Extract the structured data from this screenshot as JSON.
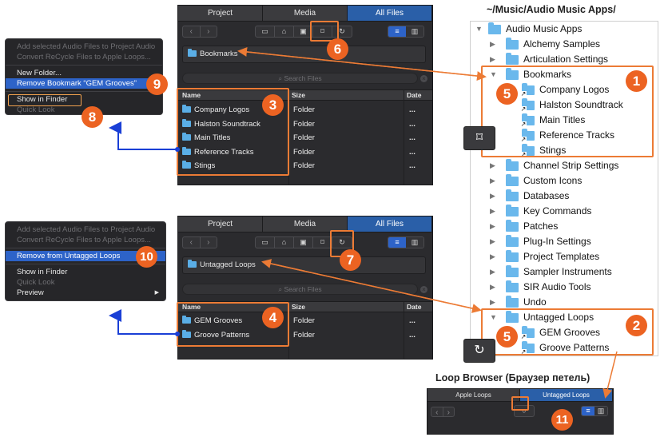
{
  "menu_top": {
    "items": [
      {
        "label": "Add selected Audio Files to Project Audio",
        "state": "disabled"
      },
      {
        "label": "Convert ReCycle Files to Apple Loops...",
        "state": "disabled"
      },
      {
        "sep": true
      },
      {
        "label": "New Folder...",
        "state": "normal"
      },
      {
        "label": "Remove Bookmark “GEM Grooves”",
        "state": "selected"
      },
      {
        "sep": true
      },
      {
        "label": "Show in Finder",
        "state": "normal"
      },
      {
        "label": "Quick Look",
        "state": "disabled"
      }
    ]
  },
  "menu_bottom": {
    "items": [
      {
        "label": "Add selected Audio Files to Project Audio",
        "state": "disabled"
      },
      {
        "label": "Convert ReCycle Files to Apple Loops...",
        "state": "disabled"
      },
      {
        "sep": true
      },
      {
        "label": "Remove from Untagged Loops",
        "state": "selected"
      },
      {
        "sep": true
      },
      {
        "label": "Show in Finder",
        "state": "normal"
      },
      {
        "label": "Quick Look",
        "state": "disabled"
      },
      {
        "label": "Preview",
        "state": "normal",
        "submenu": true
      }
    ]
  },
  "browser_top": {
    "tabs": [
      "Project",
      "Media",
      "All Files"
    ],
    "active_tab": 2,
    "path": "Bookmarks",
    "search_placeholder": "Search Files",
    "columns": [
      "Name",
      "Size",
      "Date"
    ],
    "rows": [
      {
        "name": "Company Logos",
        "size": "Folder",
        "date": "..."
      },
      {
        "name": "Halston Soundtrack",
        "size": "Folder",
        "date": "..."
      },
      {
        "name": "Main Titles",
        "size": "Folder",
        "date": "..."
      },
      {
        "name": "Reference Tracks",
        "size": "Folder",
        "date": "..."
      },
      {
        "name": "Stings",
        "size": "Folder",
        "date": "..."
      }
    ]
  },
  "browser_bottom": {
    "tabs": [
      "Project",
      "Media",
      "All Files"
    ],
    "active_tab": 2,
    "path": "Untagged Loops",
    "search_placeholder": "Search Files",
    "columns": [
      "Name",
      "Size",
      "Date"
    ],
    "rows": [
      {
        "name": "GEM Grooves",
        "size": "Folder",
        "date": "..."
      },
      {
        "name": "Groove Patterns",
        "size": "Folder",
        "date": "..."
      }
    ]
  },
  "finder": {
    "caption": "~/Music/Audio Music Apps/",
    "root": "Audio Music Apps",
    "rows": [
      {
        "label": "Alchemy Samples",
        "level": 1,
        "expanded": false
      },
      {
        "label": "Articulation Settings",
        "level": 1,
        "expanded": false
      },
      {
        "label": "Bookmarks",
        "level": 1,
        "expanded": true
      },
      {
        "label": "Company Logos",
        "level": 2,
        "alias": true
      },
      {
        "label": "Halston Soundtrack",
        "level": 2,
        "alias": true
      },
      {
        "label": "Main Titles",
        "level": 2,
        "alias": true
      },
      {
        "label": "Reference Tracks",
        "level": 2,
        "alias": true
      },
      {
        "label": "Stings",
        "level": 2,
        "alias": true
      },
      {
        "label": "Channel Strip Settings",
        "level": 1,
        "expanded": false
      },
      {
        "label": "Custom Icons",
        "level": 1,
        "expanded": false
      },
      {
        "label": "Databases",
        "level": 1,
        "expanded": false
      },
      {
        "label": "Key Commands",
        "level": 1,
        "expanded": false
      },
      {
        "label": "Patches",
        "level": 1,
        "expanded": false
      },
      {
        "label": "Plug-In Settings",
        "level": 1,
        "expanded": false
      },
      {
        "label": "Project Templates",
        "level": 1,
        "expanded": false
      },
      {
        "label": "Sampler Instruments",
        "level": 1,
        "expanded": false
      },
      {
        "label": "SIR Audio Tools",
        "level": 1,
        "expanded": false
      },
      {
        "label": "Undo",
        "level": 1,
        "expanded": false
      },
      {
        "label": "Untagged Loops",
        "level": 1,
        "expanded": true
      },
      {
        "label": "GEM Grooves",
        "level": 2,
        "alias": true
      },
      {
        "label": "Groove Patterns",
        "level": 2,
        "alias": true
      }
    ]
  },
  "loop_browser": {
    "caption": "Loop Browser (Браузер петель)",
    "tabs": [
      "Apple Loops",
      "Untagged Loops"
    ],
    "active_tab": 1
  },
  "badges": [
    "1",
    "2",
    "3",
    "4",
    "5",
    "5",
    "6",
    "7",
    "8",
    "9",
    "10",
    "11"
  ],
  "colors": {
    "accent": "#ec6322",
    "arrow_orange": "#ec7b35",
    "arrow_blue": "#1a3fd6",
    "selection": "#2d63c8",
    "folder": "#5aaee6"
  }
}
